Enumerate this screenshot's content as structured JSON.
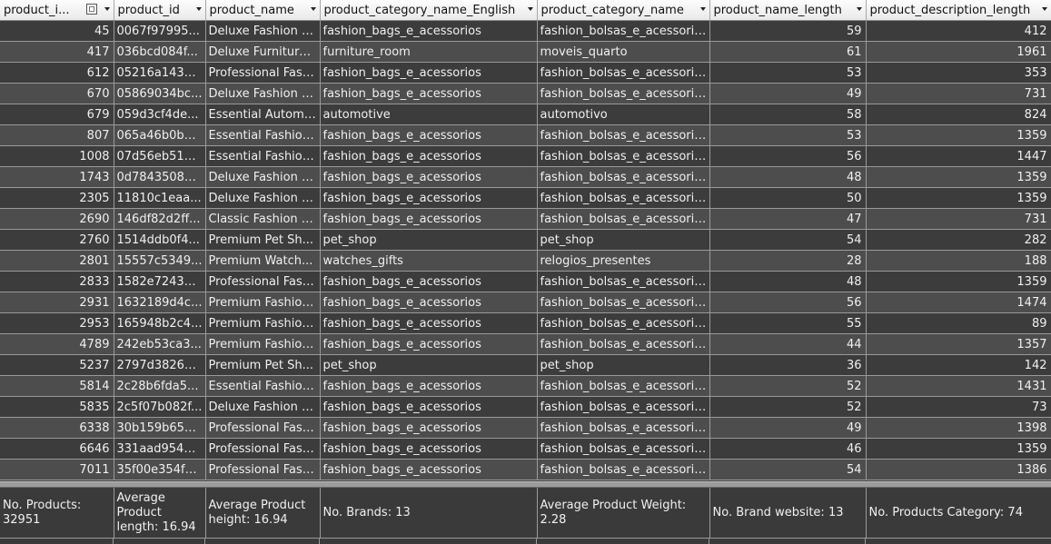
{
  "columns": [
    {
      "label": "product_i...",
      "name": "column-header-product-index"
    },
    {
      "label": "product_id",
      "name": "column-header-product-id"
    },
    {
      "label": "product_name",
      "name": "column-header-product-name"
    },
    {
      "label": "product_category_name_English",
      "name": "column-header-category-english"
    },
    {
      "label": "product_category_name",
      "name": "column-header-category-name"
    },
    {
      "label": "product_name_length",
      "name": "column-header-name-length"
    },
    {
      "label": "product_description_length",
      "name": "column-header-description-length"
    }
  ],
  "rows": [
    [
      "45",
      "0067f97995...",
      "Deluxe Fashion B...",
      "fashion_bags_e_acessorios",
      "fashion_bolsas_e_acessorios",
      "59",
      "412"
    ],
    [
      "417",
      "036bcd084f...",
      "Deluxe Furniture ...",
      "furniture_room",
      "moveis_quarto",
      "61",
      "1961"
    ],
    [
      "612",
      "05216a143a...",
      "Professional Fashi...",
      "fashion_bags_e_acessorios",
      "fashion_bolsas_e_acessorios",
      "53",
      "353"
    ],
    [
      "670",
      "05869034bc...",
      "Deluxe Fashion B...",
      "fashion_bags_e_acessorios",
      "fashion_bolsas_e_acessorios",
      "49",
      "731"
    ],
    [
      "679",
      "059d3cf4de...",
      "Essential Automo...",
      "automotive",
      "automotivo",
      "58",
      "824"
    ],
    [
      "807",
      "065a46b0be...",
      "Essential Fashion ...",
      "fashion_bags_e_acessorios",
      "fashion_bolsas_e_acessorios",
      "53",
      "1359"
    ],
    [
      "1008",
      "07d56eb519...",
      "Essential Fashion ...",
      "fashion_bags_e_acessorios",
      "fashion_bolsas_e_acessorios",
      "56",
      "1447"
    ],
    [
      "1743",
      "0d78435088...",
      "Deluxe Fashion B...",
      "fashion_bags_e_acessorios",
      "fashion_bolsas_e_acessorios",
      "48",
      "1359"
    ],
    [
      "2305",
      "11810c1eaa...",
      "Deluxe Fashion B...",
      "fashion_bags_e_acessorios",
      "fashion_bolsas_e_acessorios",
      "50",
      "1359"
    ],
    [
      "2690",
      "146df82d2ff...",
      "Classic Fashion B...",
      "fashion_bags_e_acessorios",
      "fashion_bolsas_e_acessorios",
      "47",
      "731"
    ],
    [
      "2760",
      "1514ddb0f4...",
      "Premium Pet Sh...",
      "pet_shop",
      "pet_shop",
      "54",
      "282"
    ],
    [
      "2801",
      "15557c5349...",
      "Premium Watch...",
      "watches_gifts",
      "relogios_presentes",
      "28",
      "188"
    ],
    [
      "2833",
      "1582e72435...",
      "Professional Fashi...",
      "fashion_bags_e_acessorios",
      "fashion_bolsas_e_acessorios",
      "48",
      "1359"
    ],
    [
      "2931",
      "1632189d4c...",
      "Premium Fashion...",
      "fashion_bags_e_acessorios",
      "fashion_bolsas_e_acessorios",
      "56",
      "1474"
    ],
    [
      "2953",
      "165948b2c4...",
      "Premium Fashion...",
      "fashion_bags_e_acessorios",
      "fashion_bolsas_e_acessorios",
      "55",
      "89"
    ],
    [
      "4789",
      "242eb53ca3...",
      "Premium Fashion...",
      "fashion_bags_e_acessorios",
      "fashion_bolsas_e_acessorios",
      "44",
      "1357"
    ],
    [
      "5237",
      "2797d3826d...",
      "Premium Pet Sh...",
      "pet_shop",
      "pet_shop",
      "36",
      "142"
    ],
    [
      "5814",
      "2c28b6fda5...",
      "Essential Fashion ...",
      "fashion_bags_e_acessorios",
      "fashion_bolsas_e_acessorios",
      "52",
      "1431"
    ],
    [
      "5835",
      "2c5f07b082f...",
      "Deluxe Fashion B...",
      "fashion_bags_e_acessorios",
      "fashion_bolsas_e_acessorios",
      "52",
      "73"
    ],
    [
      "6338",
      "30b159b653...",
      "Professional Fashi...",
      "fashion_bags_e_acessorios",
      "fashion_bolsas_e_acessorios",
      "49",
      "1398"
    ],
    [
      "6646",
      "331aad9546...",
      "Professional Fashi...",
      "fashion_bags_e_acessorios",
      "fashion_bolsas_e_acessorios",
      "46",
      "1359"
    ],
    [
      "7011",
      "35f00e354f3...",
      "Professional Fashi...",
      "fashion_bags_e_acessorios",
      "fashion_bolsas_e_acessorios",
      "54",
      "1386"
    ]
  ],
  "summary": [
    {
      "name": "summary-no-products",
      "text": "No. Products: 32951"
    },
    {
      "name": "summary-average-product-length",
      "text": "Average Product length: 16.94"
    },
    {
      "name": "summary-average-product-height",
      "text": "Average Product height: 16.94"
    },
    {
      "name": "summary-no-brands",
      "text": "No. Brands: 13"
    },
    {
      "name": "summary-average-product-weight",
      "text": "Average Product Weight: 2.28"
    },
    {
      "name": "summary-no-brand-website",
      "text": "No. Brand website: 13"
    },
    {
      "name": "summary-no-products-category",
      "text": "No. Products Category: 74"
    }
  ],
  "icons": {
    "header_filter": "filter-icon",
    "header_sort": "sort-dropdown-icon"
  }
}
